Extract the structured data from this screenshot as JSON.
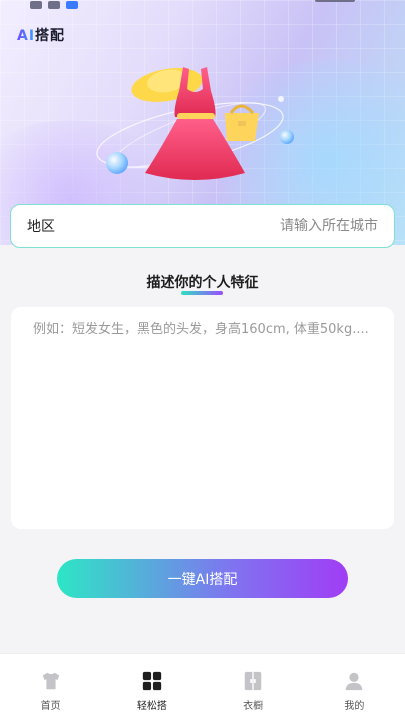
{
  "app": {
    "brand_ai": "AI",
    "brand_rest": "搭配"
  },
  "region": {
    "label": "地区",
    "placeholder": "请输入所在城市",
    "value": ""
  },
  "description": {
    "title": "描述你的个人特征",
    "placeholder": "例如：短发女生，黑色的头发，身高160cm, 体重50kg....",
    "value": ""
  },
  "cta": {
    "label": "一键AI搭配"
  },
  "colors": {
    "accent_start": "#2de6c5",
    "accent_end": "#a03df5",
    "region_border": "#7fe0d4"
  },
  "tabbar": {
    "active_index": 1,
    "items": [
      {
        "label": "首页",
        "icon": "tshirt-icon"
      },
      {
        "label": "轻松搭",
        "icon": "grid-icon"
      },
      {
        "label": "衣橱",
        "icon": "wardrobe-icon"
      },
      {
        "label": "我的",
        "icon": "person-icon"
      }
    ]
  }
}
